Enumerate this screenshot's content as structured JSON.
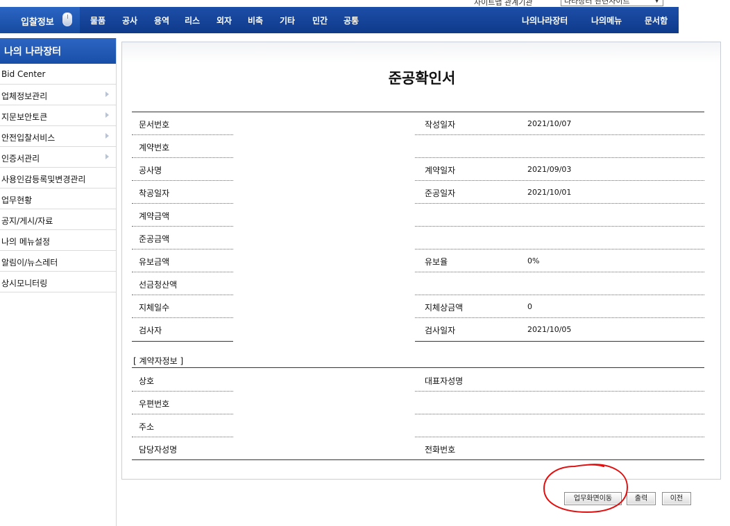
{
  "topbar": {
    "site_link_label": "사이트맵 관계기관",
    "site_select_value": "나라장터 관련사이트"
  },
  "nav": {
    "bid_info": "입찰정보",
    "items": [
      "물품",
      "공사",
      "용역",
      "리스",
      "외자",
      "비축",
      "기타",
      "민간",
      "공통"
    ],
    "right_items": [
      "나의나라장터",
      "나의메뉴",
      "문서함"
    ]
  },
  "sidebar": {
    "title": "나의 나라장터",
    "items": [
      {
        "label": "Bid Center",
        "has_arrow": false
      },
      {
        "label": "업체정보관리",
        "has_arrow": true
      },
      {
        "label": "지문보안토큰",
        "has_arrow": true
      },
      {
        "label": "안전입찰서비스",
        "has_arrow": true
      },
      {
        "label": "인증서관리",
        "has_arrow": true
      },
      {
        "label": "사용인감등록및변경관리",
        "has_arrow": false
      },
      {
        "label": "업무현황",
        "has_arrow": false
      },
      {
        "label": "공지/게시/자료",
        "has_arrow": false
      },
      {
        "label": "나의 메뉴설정",
        "has_arrow": false
      },
      {
        "label": "알림이/뉴스레터",
        "has_arrow": false
      },
      {
        "label": "상시모니터링",
        "has_arrow": false
      }
    ]
  },
  "document": {
    "title": "준공확인서",
    "left": {
      "doc_no": "문서번호",
      "contract_no": "계약번호",
      "project_name": "공사명",
      "start_date": "착공일자",
      "contract_amount": "계약금액",
      "completion_amount": "준공금액",
      "retention_amount": "유보금액",
      "advance_settlement": "선금청산액",
      "delay_days": "지체일수",
      "inspector": "검사자",
      "contractor_section": "[ 계약자정보 ]",
      "company": "상호",
      "postal_code": "우편번호",
      "address": "주소",
      "manager_name": "담당자성명"
    },
    "right": {
      "created_date_label": "작성일자",
      "created_date_value": "2021/10/07",
      "contract_date_label": "계약일자",
      "contract_date_value": "2021/09/03",
      "completion_date_label": "준공일자",
      "completion_date_value": "2021/10/01",
      "retention_rate_label": "유보율",
      "retention_rate_value": "0%",
      "delay_penalty_label": "지체상금액",
      "delay_penalty_value": "0",
      "inspection_date_label": "검사일자",
      "inspection_date_value": "2021/10/05",
      "ceo_name_label": "대표자성명",
      "phone_label": "전화번호"
    }
  },
  "buttons": {
    "goto_work": "업무화면이동",
    "print": "출력",
    "prev": "이전"
  },
  "colors": {
    "nav_blue": "#1c4ea8",
    "annotation_red": "#e01010"
  }
}
